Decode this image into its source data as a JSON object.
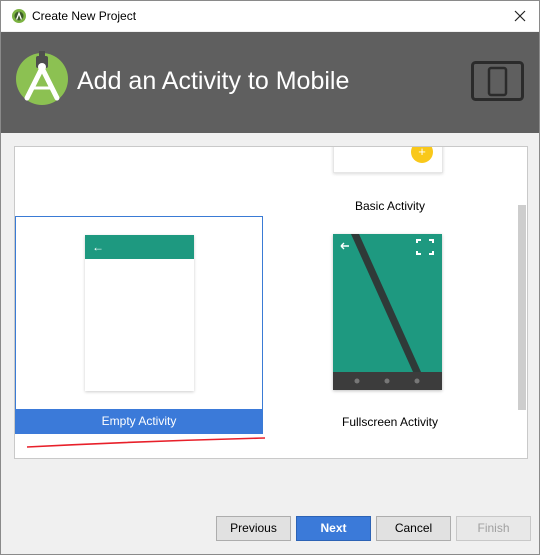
{
  "window": {
    "title": "Create New Project",
    "app_icon": "android-studio-icon",
    "close_icon": "close-icon"
  },
  "header": {
    "title": "Add an Activity to Mobile",
    "logo": "android-studio-logo",
    "device_icon": "phone-tablet-icon"
  },
  "gallery": {
    "templates": [
      {
        "label": "Basic Activity",
        "icon": "fab-plus-icon",
        "selected": false
      },
      {
        "label": "Empty Activity",
        "icon": "back-arrow-icon",
        "selected": true
      },
      {
        "label": "Fullscreen Activity",
        "icon": "fullscreen-icon",
        "selected": false
      }
    ]
  },
  "buttons": {
    "previous": "Previous",
    "next": "Next",
    "cancel": "Cancel",
    "finish": "Finish"
  },
  "colors": {
    "header_bg": "#5f5f5f",
    "android_green": "#8cc152",
    "teal": "#1e9980",
    "selection_blue": "#3b7ad9",
    "fab_yellow": "#f9c81a",
    "annotation_red": "#e8202a"
  }
}
